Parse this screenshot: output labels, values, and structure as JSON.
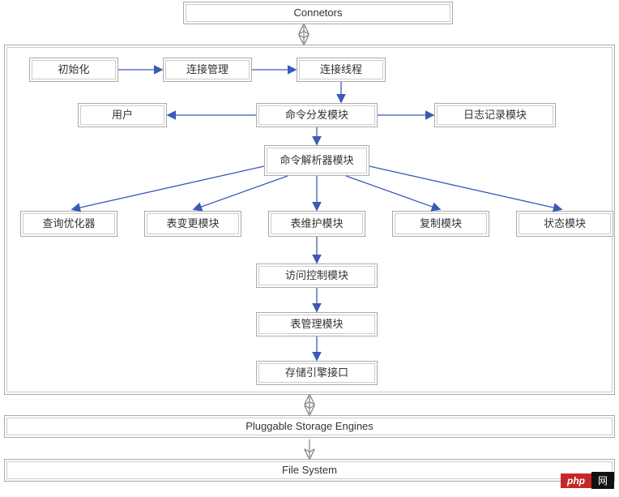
{
  "chart_data": {
    "type": "diagram",
    "title": "",
    "nodes": [
      {
        "id": "connectors",
        "label": "Connetors"
      },
      {
        "id": "init",
        "label": "初始化"
      },
      {
        "id": "conn_mgmt",
        "label": "连接管理"
      },
      {
        "id": "conn_thread",
        "label": "连接线程"
      },
      {
        "id": "user",
        "label": "用户"
      },
      {
        "id": "dispatch",
        "label": "命令分发模块"
      },
      {
        "id": "log",
        "label": "日志记录模块"
      },
      {
        "id": "parser",
        "label": "命令解析器模块"
      },
      {
        "id": "optimizer",
        "label": "查询优化器"
      },
      {
        "id": "alter",
        "label": "表变更模块"
      },
      {
        "id": "maintain",
        "label": "表维护模块"
      },
      {
        "id": "replicate",
        "label": "复制模块"
      },
      {
        "id": "status",
        "label": "状态模块"
      },
      {
        "id": "access_ctrl",
        "label": "访问控制模块"
      },
      {
        "id": "table_mgmt",
        "label": "表管理模块"
      },
      {
        "id": "storage_if",
        "label": "存储引擎接口"
      },
      {
        "id": "pluggable",
        "label": "Pluggable Storage Engines"
      },
      {
        "id": "filesystem",
        "label": "File System"
      }
    ],
    "edges": [
      {
        "from": "connectors",
        "to": "main_container",
        "style": "open-both"
      },
      {
        "from": "init",
        "to": "conn_mgmt",
        "style": "arrow"
      },
      {
        "from": "conn_mgmt",
        "to": "conn_thread",
        "style": "arrow"
      },
      {
        "from": "conn_thread",
        "to": "dispatch",
        "style": "arrow"
      },
      {
        "from": "dispatch",
        "to": "user",
        "style": "arrow"
      },
      {
        "from": "dispatch",
        "to": "log",
        "style": "arrow"
      },
      {
        "from": "dispatch",
        "to": "parser",
        "style": "arrow"
      },
      {
        "from": "parser",
        "to": "optimizer",
        "style": "arrow"
      },
      {
        "from": "parser",
        "to": "alter",
        "style": "arrow"
      },
      {
        "from": "parser",
        "to": "maintain",
        "style": "arrow"
      },
      {
        "from": "parser",
        "to": "replicate",
        "style": "arrow"
      },
      {
        "from": "parser",
        "to": "status",
        "style": "arrow"
      },
      {
        "from": "maintain",
        "to": "access_ctrl",
        "style": "arrow"
      },
      {
        "from": "access_ctrl",
        "to": "table_mgmt",
        "style": "arrow"
      },
      {
        "from": "table_mgmt",
        "to": "storage_if",
        "style": "arrow"
      },
      {
        "from": "main_container",
        "to": "pluggable",
        "style": "open-both"
      },
      {
        "from": "pluggable",
        "to": "filesystem",
        "style": "open"
      }
    ]
  },
  "watermark": {
    "php": "php",
    "text": "网"
  }
}
